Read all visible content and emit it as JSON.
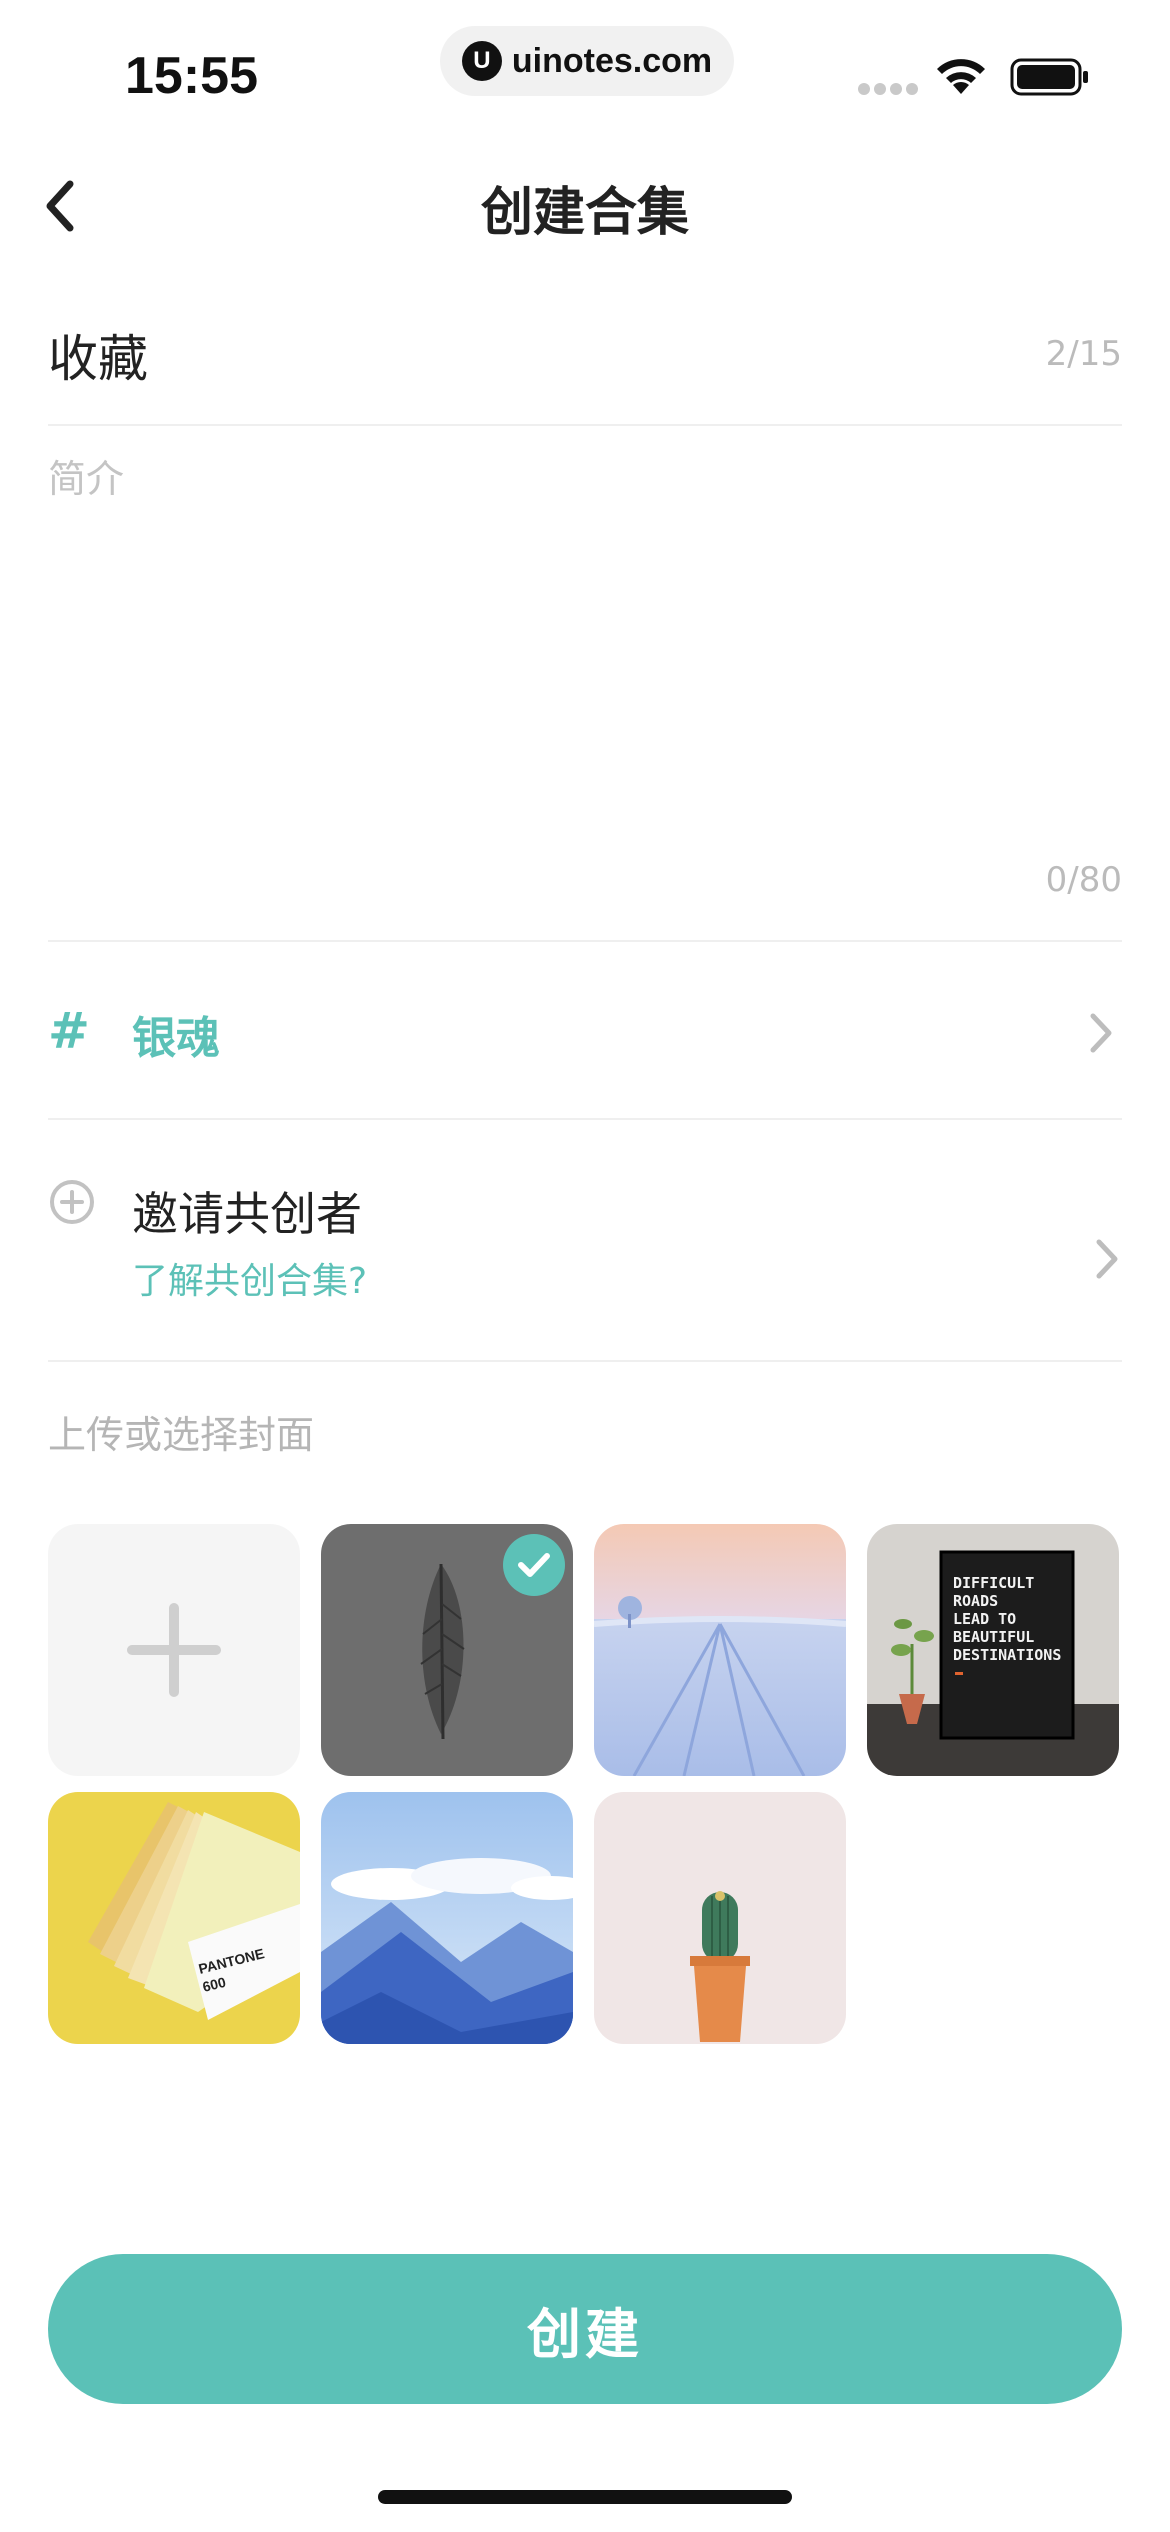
{
  "status_bar": {
    "time": "15:55",
    "url": "uinotes.com",
    "url_logo_letter": "U"
  },
  "nav": {
    "title": "创建合集"
  },
  "title_field": {
    "value": "收藏",
    "count": "2/15"
  },
  "intro_field": {
    "placeholder": "简介",
    "value": "",
    "count": "0/80"
  },
  "tag": {
    "symbol": "#",
    "label": "银魂"
  },
  "invite": {
    "label": "邀请共创者",
    "link": "了解共创合集?"
  },
  "cover": {
    "label": "上传或选择封面",
    "selected_index": 1,
    "images": [
      {
        "name": "leaf"
      },
      {
        "name": "snow-field"
      },
      {
        "name": "letter-board",
        "text_lines": [
          "DIFFICULT",
          "ROADS",
          "LEAD TO",
          "BEAUTIFUL",
          "DESTINATIONS"
        ]
      },
      {
        "name": "pantone",
        "text_lines": [
          "PANTONE",
          "600"
        ]
      },
      {
        "name": "mountains"
      },
      {
        "name": "cactus"
      }
    ]
  },
  "actions": {
    "create_label": "创建"
  },
  "colors": {
    "accent": "#5cc1b7",
    "placeholder": "#c4c4c4",
    "divider": "#efefef"
  }
}
